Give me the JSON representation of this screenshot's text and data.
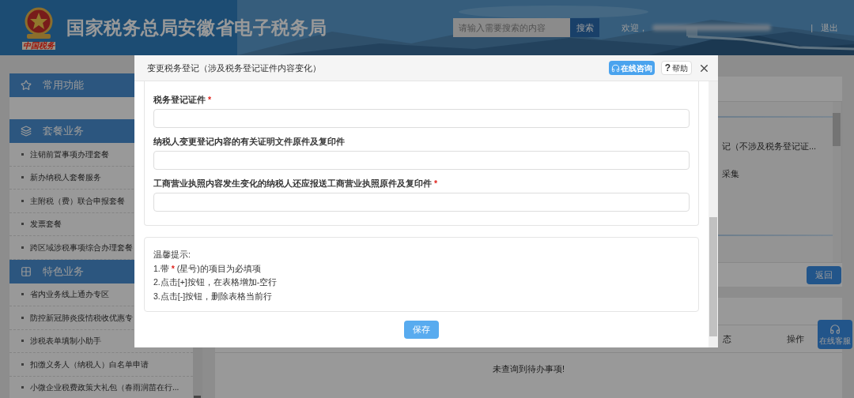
{
  "header": {
    "title": "国家税务总局安徽省电子税务局",
    "logo_caption": "中国税务",
    "search": {
      "placeholder": "请输入需要搜索的内容",
      "button": "搜索"
    },
    "welcome": "欢迎，",
    "separator": "|",
    "logout": "退出"
  },
  "sidebar": {
    "sections": [
      {
        "title": "常用功能"
      },
      {
        "title": "套餐业务",
        "items": [
          "注销前置事项办理套餐",
          "新办纳税人套餐服务",
          "主附税（费）联合申报套餐",
          "发票套餐",
          "跨区域涉税事项综合办理套餐"
        ]
      },
      {
        "title": "特色业务",
        "items": [
          "省内业务线上通办专区",
          "防控新冠肺炎疫情税收优惠专",
          "涉税表单填制小助手",
          "扣缴义务人（纳税人）白名单申请",
          "小微企业税费政策大礼包（春雨润苗在行..."
        ]
      }
    ]
  },
  "background_panel": {
    "lines": [
      "记（不涉及税务登记证...",
      "采集"
    ],
    "back_button": "返回"
  },
  "todo_panel": {
    "columns": [
      "态",
      "操作"
    ],
    "empty_message": "未查询到待办事项!"
  },
  "float_button": "在线客服",
  "modal": {
    "title": "变更税务登记（涉及税务登记证件内容变化）",
    "consult_button": "在线咨询",
    "help_glyph": "?",
    "help_button": "帮助",
    "fields": [
      {
        "label": "税务登记证件",
        "required": true
      },
      {
        "label": "纳税人变更登记内容的有关证明文件原件及复印件",
        "required": false
      },
      {
        "label": "工商营业执照内容发生变化的纳税人还应报送工商营业执照原件及复印件",
        "required": true
      }
    ],
    "tips": {
      "title": "温馨提示:",
      "lines": [
        [
          {
            "kind": "text",
            "text": "1.带"
          },
          {
            "kind": "mark",
            "text": "*"
          },
          {
            "kind": "text",
            "text": "(星号)的项目为必填项"
          }
        ],
        [
          {
            "kind": "text",
            "text": "2.点击[+]按钮，在表格增加-空行"
          }
        ],
        [
          {
            "kind": "text",
            "text": "3.点击[-]按钮，删除表格当前行"
          }
        ]
      ]
    },
    "save_button": "保存"
  }
}
